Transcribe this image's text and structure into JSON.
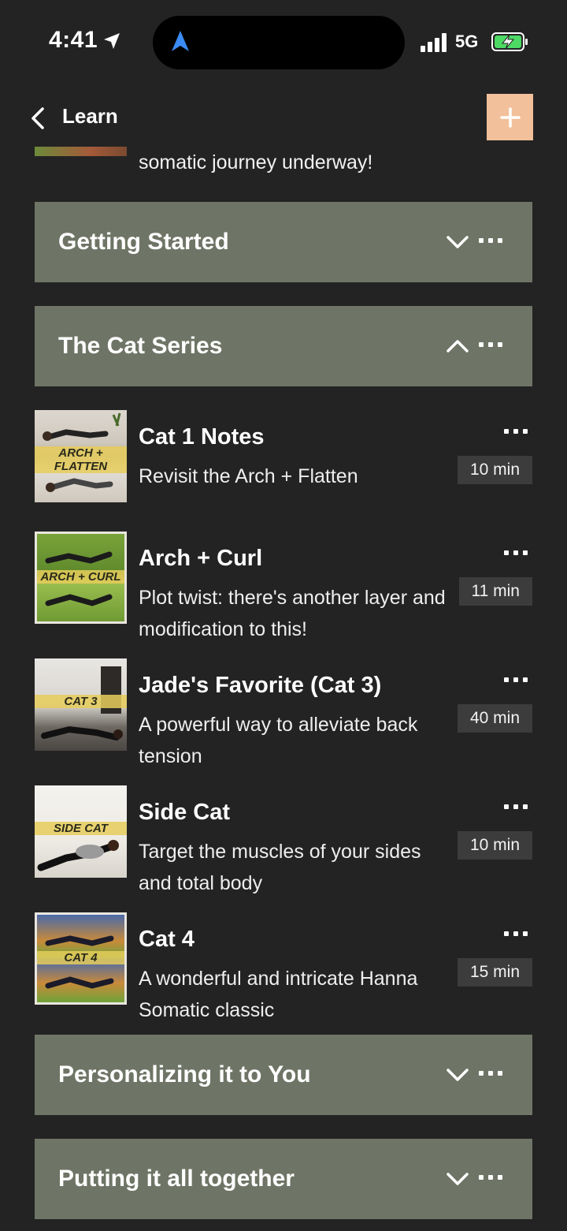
{
  "status_bar": {
    "time": "4:41",
    "network": "5G",
    "icons": [
      "location-arrow-icon",
      "navigation-icon",
      "signal-icon",
      "battery-charging-icon"
    ]
  },
  "header": {
    "back_label": "Learn",
    "add_icon": "plus-icon"
  },
  "partial_item": {
    "text": "somatic journey underway!"
  },
  "sections": [
    {
      "title": "Getting Started",
      "expanded": false
    },
    {
      "title": "The Cat Series",
      "expanded": true
    },
    {
      "title": "Personalizing it to You",
      "expanded": false
    },
    {
      "title": "Putting it all together",
      "expanded": false
    }
  ],
  "lessons": [
    {
      "title": "Cat 1 Notes",
      "description": "Revisit the Arch + Flatten",
      "duration": "10 min",
      "thumb_label": "ARCH + FLATTEN"
    },
    {
      "title": "Arch + Curl",
      "description": "Plot twist: there's another layer and modification to this!",
      "duration": "11 min",
      "thumb_label": "ARCH + CURL"
    },
    {
      "title": "Jade's Favorite (Cat 3)",
      "description": "A powerful way to alleviate back tension",
      "duration": "40 min",
      "thumb_label": "CAT 3"
    },
    {
      "title": "Side Cat",
      "description": "Target the muscles of your sides and total body",
      "duration": "10 min",
      "thumb_label": "SIDE CAT"
    },
    {
      "title": "Cat 4",
      "description": "A wonderful and intricate Hanna Somatic classic",
      "duration": "15 min",
      "thumb_label": "CAT 4"
    }
  ],
  "colors": {
    "background": "#232323",
    "section": "#6f7566",
    "accent": "#f2c09a",
    "duration_chip": "#3c3c3c"
  }
}
